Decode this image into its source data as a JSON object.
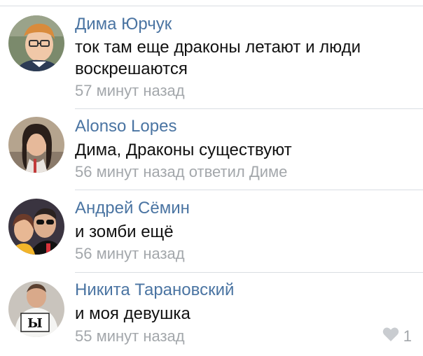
{
  "comments": [
    {
      "author": "Дима Юрчук",
      "text": "ток там еще драконы летают и люди воскрешаются",
      "time": "57 минут назад",
      "reply_to": "",
      "avatar": "avatar-dima"
    },
    {
      "author": "Alonso Lopes",
      "text": "Дима, Драконы существуют",
      "time": "56 минут назад",
      "reply_to": "ответил Диме",
      "avatar": "avatar-alonso"
    },
    {
      "author": "Андрей Сёмин",
      "text": "и зомби ещё",
      "time": "56 минут назад",
      "reply_to": "",
      "avatar": "avatar-andrey"
    },
    {
      "author": "Никита Тарановский",
      "text": "и моя девушка",
      "time": "55 минут назад",
      "reply_to": "",
      "avatar": "avatar-nikita",
      "likes": "1"
    }
  ],
  "icons": {
    "like": "heart-icon"
  },
  "colors": {
    "author": "#4a74a2",
    "meta": "#a3a7ab",
    "text": "#111111",
    "divider": "#d9dde2"
  }
}
